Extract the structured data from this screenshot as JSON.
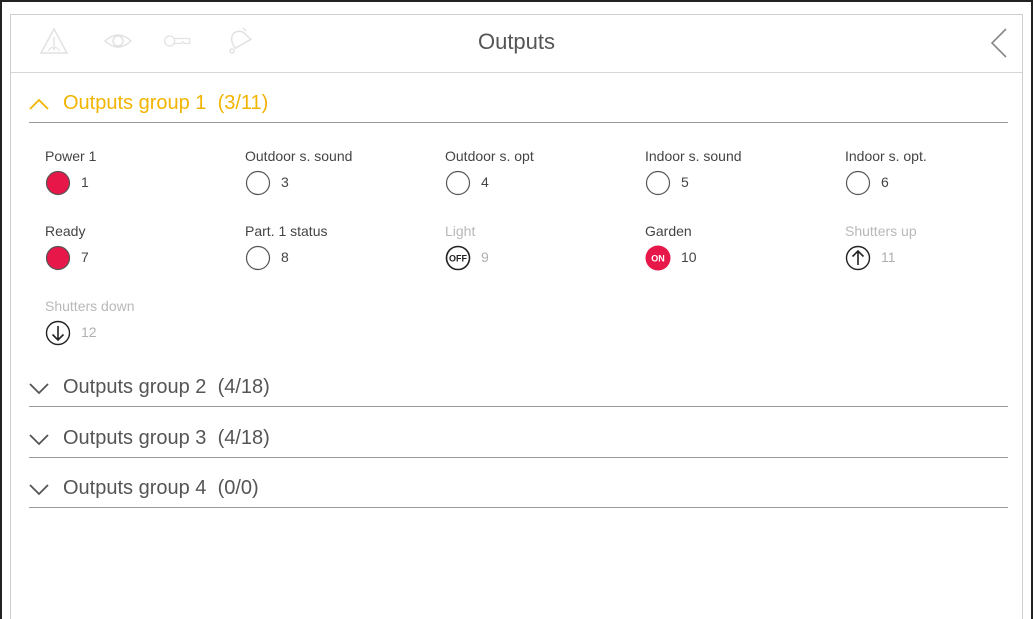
{
  "header": {
    "title": "Outputs",
    "icons": [
      "alarm-warning-icon",
      "eye-icon",
      "key-icon",
      "bell-icon"
    ],
    "back_icon": "chevron-left-icon"
  },
  "colors": {
    "accent": "#f2b400",
    "active": "#e8174a",
    "inactive_outline": "#555555",
    "dim_text": "#b8b8b8"
  },
  "groups": [
    {
      "label": "Outputs group 1",
      "count": "(3/11)",
      "expanded": true,
      "items": [
        {
          "name": "Power 1",
          "number": "1",
          "control": "state",
          "state": "on"
        },
        {
          "name": "Outdoor s. sound",
          "number": "3",
          "control": "state",
          "state": "off"
        },
        {
          "name": "Outdoor s. opt",
          "number": "4",
          "control": "state",
          "state": "off"
        },
        {
          "name": "Indoor s. sound",
          "number": "5",
          "control": "state",
          "state": "off"
        },
        {
          "name": "Indoor s. opt.",
          "number": "6",
          "control": "state",
          "state": "off"
        },
        {
          "name": "Ready",
          "number": "7",
          "control": "state",
          "state": "on"
        },
        {
          "name": "Part. 1 status",
          "number": "8",
          "control": "state",
          "state": "off"
        },
        {
          "name": "Light",
          "number": "9",
          "control": "switch",
          "state": "off",
          "badge": "OFF"
        },
        {
          "name": "Garden",
          "number": "10",
          "control": "switch",
          "state": "on",
          "badge": "ON"
        },
        {
          "name": "Shutters up",
          "number": "11",
          "control": "shutter-up"
        },
        {
          "name": "Shutters down",
          "number": "12",
          "control": "shutter-down"
        }
      ]
    },
    {
      "label": "Outputs group 2",
      "count": "(4/18)",
      "expanded": false
    },
    {
      "label": "Outputs group 3",
      "count": "(4/18)",
      "expanded": false
    },
    {
      "label": "Outputs group 4",
      "count": "(0/0)",
      "expanded": false
    }
  ]
}
